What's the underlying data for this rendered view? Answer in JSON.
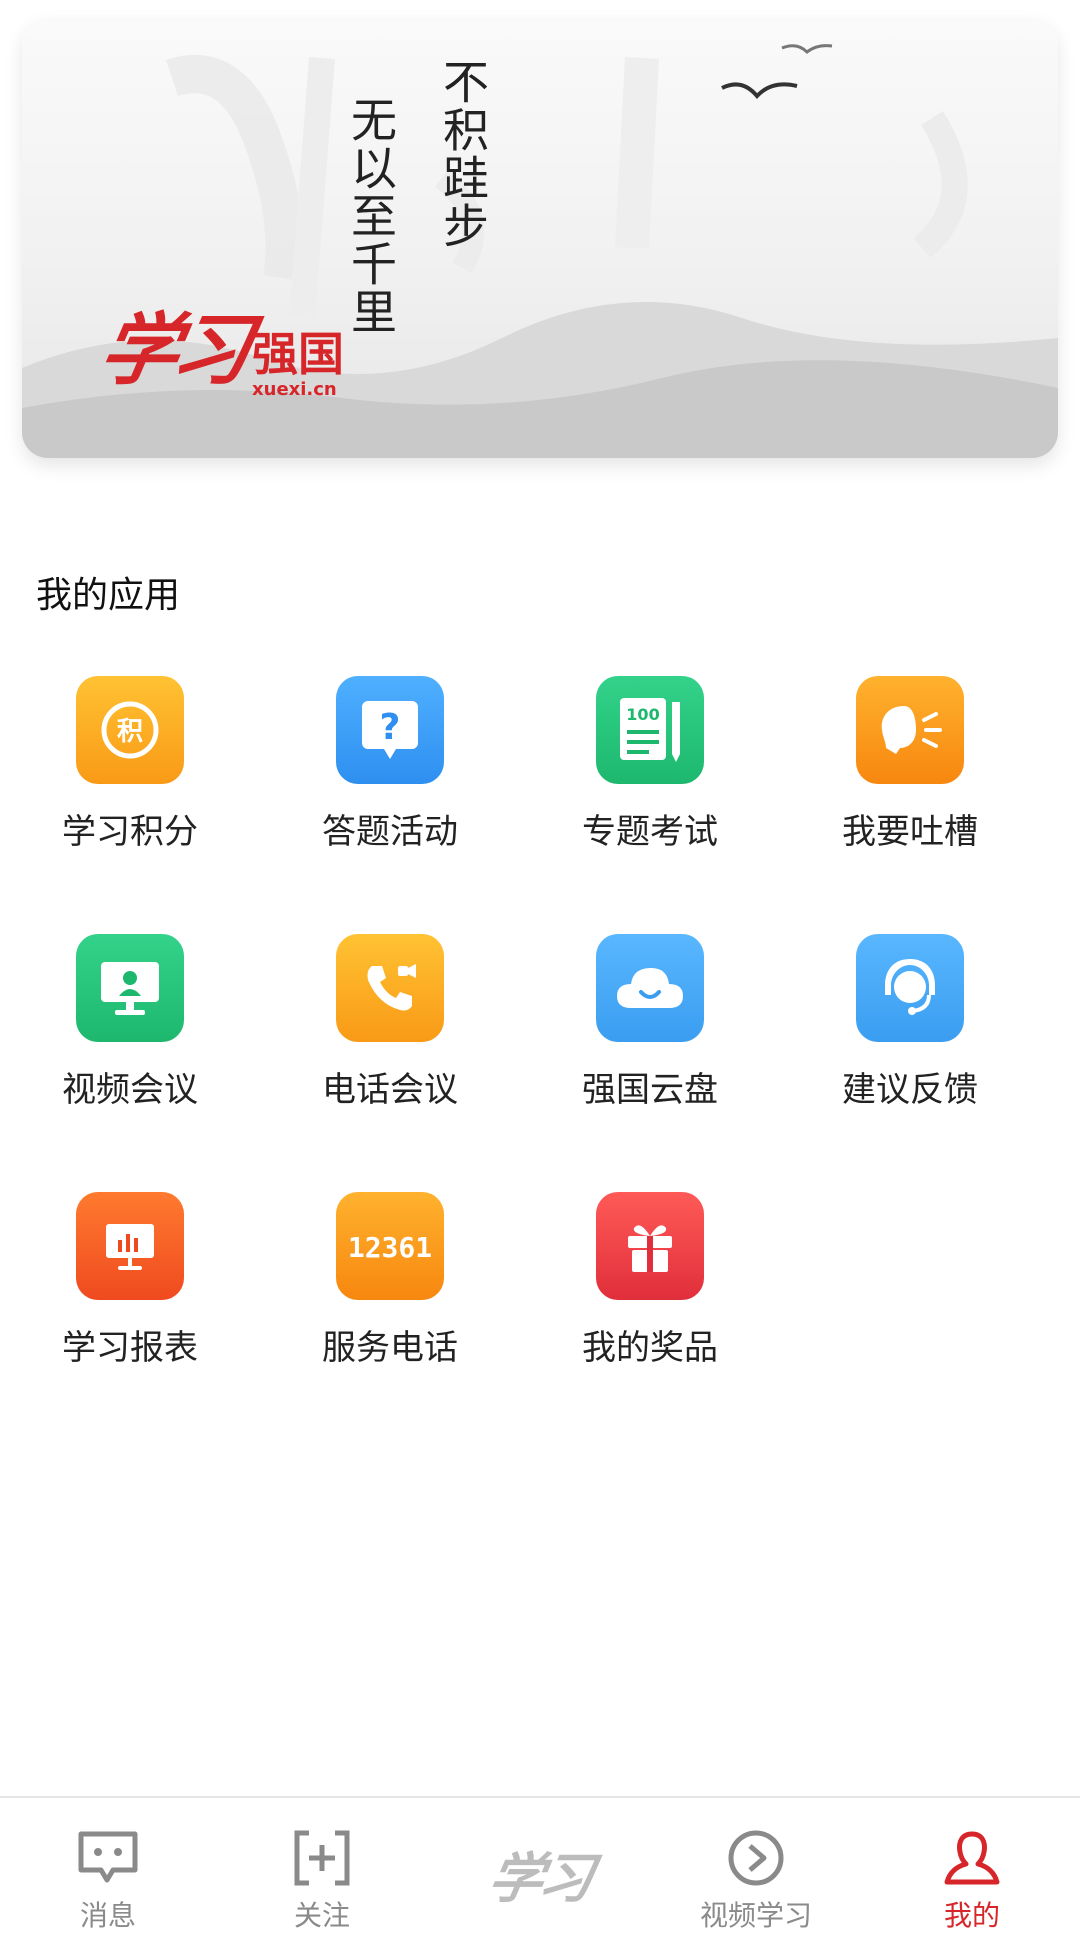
{
  "banner": {
    "poem_line1": "不积跬步",
    "poem_line2": "无以至千里",
    "logo_script": "学习",
    "logo_brand": "强国",
    "logo_domain": "xuexi.cn"
  },
  "section": {
    "title": "我的应用"
  },
  "apps": [
    {
      "label": "学习积分",
      "icon": "points-icon",
      "glyph": "积"
    },
    {
      "label": "答题活动",
      "icon": "question-icon",
      "glyph": "?"
    },
    {
      "label": "专题考试",
      "icon": "exam-icon",
      "glyph": "100"
    },
    {
      "label": "我要吐槽",
      "icon": "speak-icon"
    },
    {
      "label": "视频会议",
      "icon": "video-meeting-icon"
    },
    {
      "label": "电话会议",
      "icon": "phone-meeting-icon"
    },
    {
      "label": "强国云盘",
      "icon": "cloud-icon"
    },
    {
      "label": "建议反馈",
      "icon": "feedback-icon"
    },
    {
      "label": "学习报表",
      "icon": "report-icon"
    },
    {
      "label": "服务电话",
      "icon": "hotline-icon",
      "glyph": "12361"
    },
    {
      "label": "我的奖品",
      "icon": "gift-icon"
    }
  ],
  "nav": {
    "items": [
      {
        "label": "消息",
        "icon": "message-icon"
      },
      {
        "label": "关注",
        "icon": "follow-icon"
      },
      {
        "label": "学习",
        "icon": "xuexi-logo-icon"
      },
      {
        "label": "视频学习",
        "icon": "video-play-icon"
      },
      {
        "label": "我的",
        "icon": "profile-icon"
      }
    ],
    "active_color": "#d6262a",
    "inactive_color": "#8a8a8a"
  },
  "colors": {
    "orange": "#f9a825",
    "blue": "#3a9df0",
    "green": "#23c174",
    "red": "#e8393b"
  }
}
